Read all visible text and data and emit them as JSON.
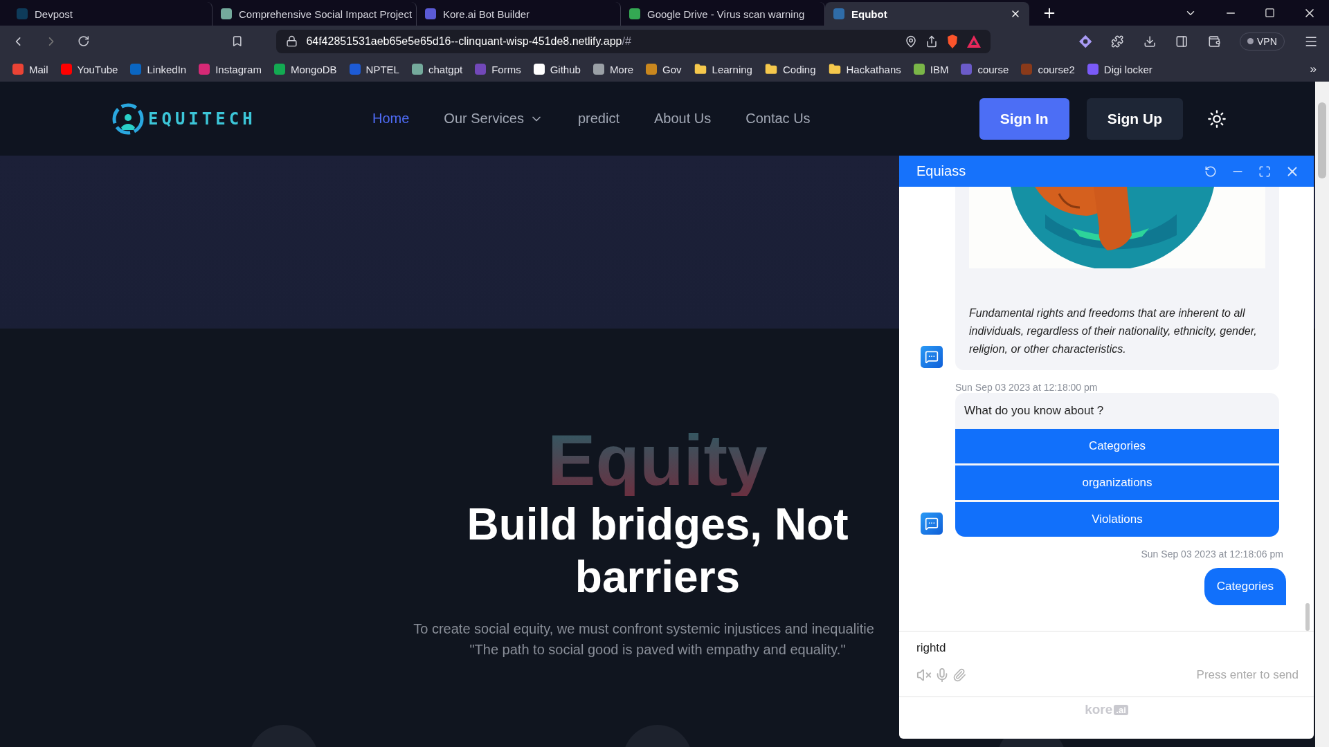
{
  "browser": {
    "tabs": [
      {
        "title": "Devpost",
        "selected": false
      },
      {
        "title": "Comprehensive Social Impact Project",
        "selected": false
      },
      {
        "title": "Kore.ai Bot Builder",
        "selected": false
      },
      {
        "title": "Google Drive - Virus scan warning",
        "selected": false
      },
      {
        "title": "Equbot",
        "selected": true
      }
    ],
    "address": {
      "url": "64f42851531aeb65e5e65d16--clinquant-wisp-451de8.netlify.app",
      "url_suffix": "/#"
    },
    "vpn_label": "VPN",
    "bookmarks": [
      {
        "label": "Mail",
        "kind": "site"
      },
      {
        "label": "YouTube",
        "kind": "site"
      },
      {
        "label": "LinkedIn",
        "kind": "site"
      },
      {
        "label": "Instagram",
        "kind": "site"
      },
      {
        "label": "MongoDB",
        "kind": "site"
      },
      {
        "label": "NPTEL",
        "kind": "site"
      },
      {
        "label": "chatgpt",
        "kind": "site"
      },
      {
        "label": "Forms",
        "kind": "site"
      },
      {
        "label": "Github",
        "kind": "site"
      },
      {
        "label": "More",
        "kind": "site"
      },
      {
        "label": "Gov",
        "kind": "site"
      },
      {
        "label": "Learning",
        "kind": "folder"
      },
      {
        "label": "Coding",
        "kind": "folder"
      },
      {
        "label": "Hackathans",
        "kind": "folder"
      },
      {
        "label": "IBM",
        "kind": "site"
      },
      {
        "label": "course",
        "kind": "site"
      },
      {
        "label": "course2",
        "kind": "site"
      },
      {
        "label": "Digi locker",
        "kind": "site"
      }
    ],
    "overflow_label": "»"
  },
  "site": {
    "logo": "EQUITECH",
    "nav": [
      {
        "label": "Home",
        "selected": true,
        "has_menu": false
      },
      {
        "label": "Our Services",
        "selected": false,
        "has_menu": true
      },
      {
        "label": "predict",
        "selected": false,
        "has_menu": false
      },
      {
        "label": "About Us",
        "selected": false,
        "has_menu": false
      },
      {
        "label": "Contac Us",
        "selected": false,
        "has_menu": false
      }
    ],
    "sign_in": "Sign In",
    "sign_up": "Sign Up",
    "hero": {
      "backdrop_word": "Equity",
      "headline": "Build bridges, Not barriers",
      "subtext": [
        "To create social equity, we must confront systemic injustices and inequalitie",
        "\"The path to social good is paved with empathy and equality.\""
      ]
    }
  },
  "chat": {
    "title": "Equiass",
    "messages": [
      {
        "from_user": false,
        "kind": "image_card",
        "text": "Fundamental rights and freedoms that are inherent to all individuals, regardless of their nationality, ethnicity, gender, religion, or other characteristics."
      },
      {
        "from_user": false,
        "kind": "options",
        "time": "Sun Sep 03 2023 at 12:18:00 pm",
        "text": "What do you know about ?",
        "options": [
          "Categories",
          "organizations",
          "Violations"
        ]
      },
      {
        "from_user": true,
        "kind": "text",
        "time": "Sun Sep 03 2023 at 12:18:06 pm",
        "text": "Categories"
      }
    ],
    "composer": {
      "value": "rightd",
      "send_hint": "Press enter to send"
    },
    "branding": {
      "word": "kore",
      "badge": ".ai"
    }
  }
}
